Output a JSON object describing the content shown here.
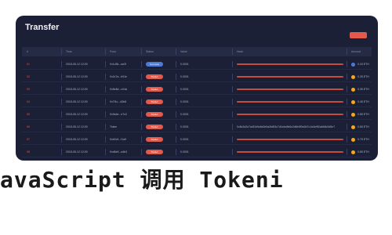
{
  "window": {
    "title": "Transfer"
  },
  "table": {
    "headers": [
      "#",
      "Time",
      "From",
      "Status",
      "Value",
      "Hash",
      "Amount"
    ],
    "rows": [
      {
        "idx": "01",
        "time": "2018-05-12 12:00",
        "from": "0x1d3b...ae2f",
        "status": "Success",
        "status_color": "blue",
        "value": "0.0001",
        "hash_text": "",
        "amount": "0.15 ETH"
      },
      {
        "idx": "02",
        "time": "2018-05-12 12:00",
        "from": "0x2c7a...b91e",
        "status": "Failed",
        "status_color": "red",
        "value": "0.0001",
        "hash_text": "",
        "amount": "0.25 ETH"
      },
      {
        "idx": "03",
        "time": "2018-05-12 12:00",
        "from": "0x5e8d...c04a",
        "status": "Failed",
        "status_color": "red",
        "value": "0.0001",
        "hash_text": "",
        "amount": "0.35 ETH"
      },
      {
        "idx": "04",
        "time": "2018-05-12 12:00",
        "from": "0x7f1c...d3b8",
        "status": "Failed",
        "status_color": "red",
        "value": "0.0001",
        "hash_text": "",
        "amount": "0.45 ETH"
      },
      {
        "idx": "05",
        "time": "2018-05-12 12:00",
        "from": "0x9a4e...e7c2",
        "status": "Failed",
        "status_color": "red",
        "value": "0.0001",
        "hash_text": "",
        "amount": "0.55 ETH"
      },
      {
        "idx": "06",
        "time": "2018-05-12 12:00",
        "from": "Token",
        "status": "Failed",
        "status_color": "red",
        "value": "0.0001",
        "hash_text": "0x8c3d2e7a4f1b9c6d0e5a2b8f3c7d1e4a9b6c2d8e5f0a3b7c1d4e9f2a6b8c3d5e7",
        "amount": "0.65 ETH"
      },
      {
        "idx": "07",
        "time": "2018-05-12 12:00",
        "from": "0xb2c5...f1a9",
        "status": "Failed",
        "status_color": "red",
        "value": "0.0001",
        "hash_text": "",
        "amount": "0.75 ETH"
      },
      {
        "idx": "08",
        "time": "2018-05-12 12:00",
        "from": "0xd6e9...a4b3",
        "status": "Failed",
        "status_color": "red",
        "value": "0.0001",
        "hash_text": "",
        "amount": "0.85 ETH"
      }
    ]
  },
  "caption": "avaScript 调用 Tokeni",
  "colors": {
    "accent": "#e5584c",
    "panel": "#1c2036",
    "blue": "#4b7bd9",
    "dot_orange": "#f5a623"
  }
}
